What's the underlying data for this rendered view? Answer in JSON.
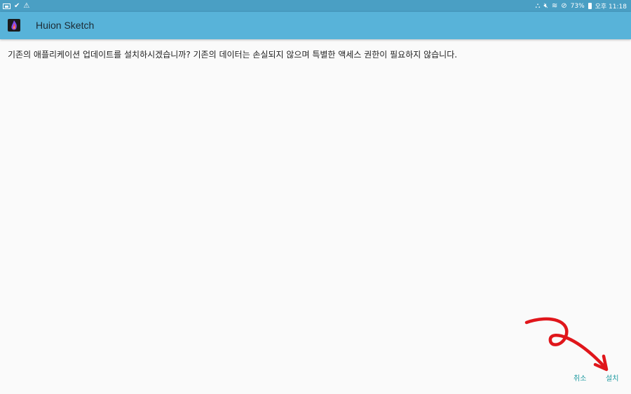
{
  "status_bar": {
    "left_icons": [
      "image-icon",
      "check-icon",
      "warning-icon"
    ],
    "right_icons": [
      "network-icon",
      "mute-icon",
      "wifi-icon",
      "no-sign-icon",
      "battery-icon"
    ],
    "battery": "73%",
    "time": "오후 11:18"
  },
  "app_bar": {
    "title": "Huion Sketch",
    "color": "#58b3d9"
  },
  "dialog": {
    "message": "기존의 애플리케이션 업데이트를 설치하시겠습니까? 기존의 데이터는 손실되지 않으며 특별한 액세스 권한이 필요하지 않습니다.",
    "cancel_label": "취소",
    "install_label": "설치",
    "button_color": "#1e9aa0"
  },
  "annotation": {
    "type": "red-curved-arrow",
    "color": "#e0161b"
  }
}
